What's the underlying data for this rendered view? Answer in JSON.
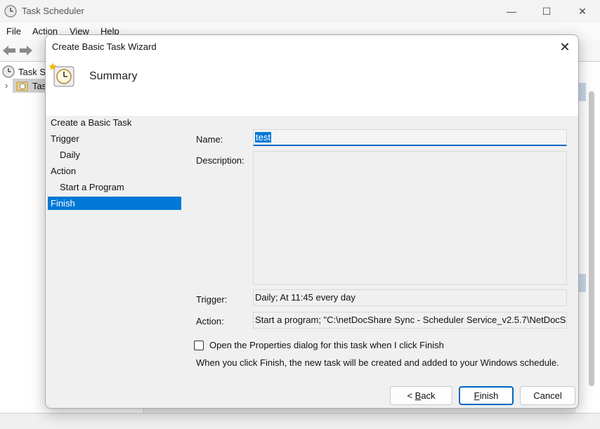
{
  "window": {
    "title": "Task Scheduler",
    "controls": {
      "minimize": "—",
      "maximize": "☐",
      "close": "✕"
    }
  },
  "menu": {
    "file": "File",
    "action": "Action",
    "view": "View",
    "help": "Help"
  },
  "tree": {
    "root_label": "Task Sc",
    "child_label": "Tas"
  },
  "dialog": {
    "title": "Create Basic Task Wizard",
    "close_glyph": "✕",
    "heading": "Summary",
    "steps": [
      {
        "label": "Create a Basic Task"
      },
      {
        "label": "Trigger"
      },
      {
        "label": "Daily"
      },
      {
        "label": "Action"
      },
      {
        "label": "Start a Program"
      },
      {
        "label": "Finish"
      }
    ],
    "active_step": "Finish",
    "fields": {
      "name_label": "Name:",
      "name_value": "test",
      "description_label": "Description:",
      "description_value": "",
      "trigger_label": "Trigger:",
      "trigger_value": "Daily; At 11:45 every day",
      "action_label": "Action:",
      "action_value": "Start a program; \"C:\\netDocShare Sync - Scheduler Service_v2.5.7\\NetDocShareS"
    },
    "open_properties_label": "Open the Properties dialog for this task when I click Finish",
    "open_properties_checked": false,
    "info_text": "When you click Finish, the new task will be created and added to your Windows schedule.",
    "buttons": {
      "back_prefix": "< ",
      "back_mnemonic": "B",
      "back_rest": "ack",
      "finish_mnemonic": "F",
      "finish_rest": "inish",
      "cancel": "Cancel"
    }
  },
  "colors": {
    "accent": "#0078d7",
    "default_button_border": "#0067c0"
  }
}
